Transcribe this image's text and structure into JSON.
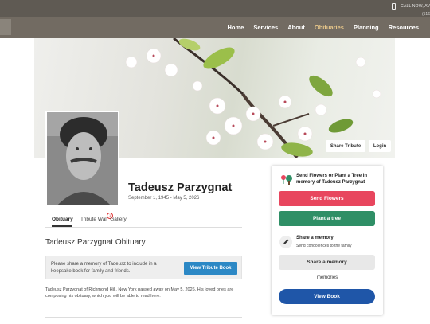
{
  "header": {
    "call_label": "CALL NOW, AV",
    "phone": "(516"
  },
  "nav": {
    "items": [
      "Home",
      "Services",
      "About",
      "Obituaries",
      "Planning",
      "Resources"
    ],
    "active": "Obituaries"
  },
  "hero": {
    "share_tribute": "Share Tribute",
    "login": "Login"
  },
  "person": {
    "name": "Tadeusz Parzygnat",
    "dates": "September 1, 1945  -  May 5, 2026"
  },
  "tabs": {
    "items": [
      "Obituary",
      "Tribute Wall",
      "Gallery"
    ],
    "badge": "1"
  },
  "obituary": {
    "title": "Tadeusz Parzygnat Obituary",
    "share_text": "Please share a memory of Tadeusz to include in a keepsake book for family and friends.",
    "view_tribute_book": "View Tribute Book",
    "body": "Tadeusz Parzygnat of Richmond Hill, New York passed away on May 5, 2026. His loved ones are composing his obituary, which you will be able to read here."
  },
  "sidebar": {
    "flowers_title": "Send Flowers or Plant a Tree in memory of Tadeusz Parzygnat",
    "send_flowers": "Send Flowers",
    "plant_tree": "Plant a tree",
    "memory_title": "Share a memory",
    "memory_sub": "Send condolences to the family",
    "share_memory": "Share a memory",
    "memories_logo": "memories",
    "view_book": "View Book"
  },
  "colors": {
    "send_flowers": "#e8465e",
    "plant_tree": "#2f8f66",
    "view_book": "#1f56a8",
    "view_tribute_book": "#2c88c5",
    "nav_active": "#e8c78a"
  }
}
